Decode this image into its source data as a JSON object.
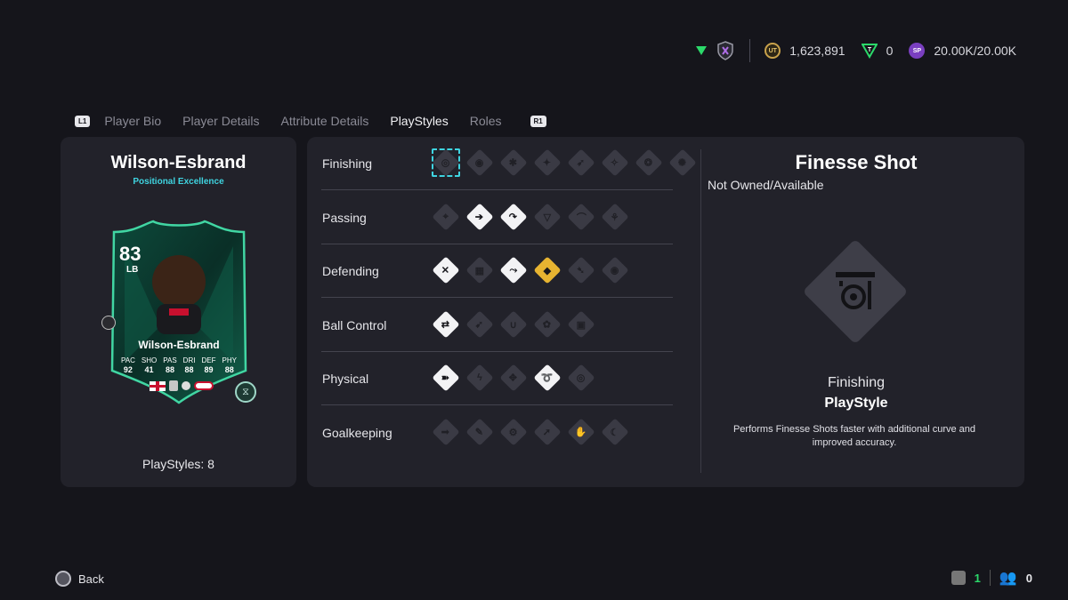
{
  "topbar": {
    "coins": "1,623,891",
    "points": "0",
    "sp": "20.00K/20.00K",
    "icons": [
      "season-triangle-icon",
      "rival-shield-icon",
      "coin-icon",
      "points-icon",
      "sp-icon"
    ]
  },
  "tabs": {
    "hint_left": "L1",
    "hint_right": "R1",
    "items": [
      {
        "label": "Player Bio"
      },
      {
        "label": "Player Details"
      },
      {
        "label": "Attribute Details"
      },
      {
        "label": "PlayStyles"
      },
      {
        "label": "Roles"
      }
    ],
    "active": "PlayStyles"
  },
  "player": {
    "name": "Wilson-Esbrand",
    "subtitle": "Positional Excellence",
    "playstyles_count": "PlayStyles: 8",
    "card": {
      "rating": "83",
      "position": "LB",
      "name": "Wilson-Esbrand",
      "stats": [
        {
          "label": "PAC",
          "value": "92"
        },
        {
          "label": "SHO",
          "value": "41"
        },
        {
          "label": "PAS",
          "value": "88"
        },
        {
          "label": "DRI",
          "value": "88"
        },
        {
          "label": "DEF",
          "value": "89"
        },
        {
          "label": "PHY",
          "value": "88"
        }
      ]
    }
  },
  "categories": [
    {
      "label": "Finishing",
      "icons": [
        {
          "name": "finesse-shot-icon",
          "state": "selected",
          "glyph": "◎"
        },
        {
          "name": "chip-shot-icon",
          "state": "locked",
          "glyph": "◉"
        },
        {
          "name": "power-shot-icon",
          "state": "locked",
          "glyph": "✱"
        },
        {
          "name": "dead-ball-icon",
          "state": "locked",
          "glyph": "✦"
        },
        {
          "name": "power-header-icon",
          "state": "locked",
          "glyph": "➶"
        },
        {
          "name": "low-driven-shot-icon",
          "state": "locked",
          "glyph": "✧"
        },
        {
          "name": "acrobatic-icon",
          "state": "locked",
          "glyph": "❂"
        },
        {
          "name": "gamechanger-icon",
          "state": "locked",
          "glyph": "✺"
        }
      ]
    },
    {
      "label": "Passing",
      "icons": [
        {
          "name": "incisive-pass-icon",
          "state": "locked",
          "glyph": "⌖"
        },
        {
          "name": "pinged-pass-icon",
          "state": "owned",
          "glyph": "➔"
        },
        {
          "name": "long-ball-pass-icon",
          "state": "owned",
          "glyph": "↷"
        },
        {
          "name": "tiki-taka-icon",
          "state": "locked",
          "glyph": "▽"
        },
        {
          "name": "whipped-pass-icon",
          "state": "locked",
          "glyph": "⌒"
        },
        {
          "name": "inventive-icon",
          "state": "locked",
          "glyph": "⚘"
        }
      ]
    },
    {
      "label": "Defending",
      "icons": [
        {
          "name": "jockey-icon",
          "state": "owned",
          "glyph": "✕"
        },
        {
          "name": "block-icon",
          "state": "locked",
          "glyph": "▦"
        },
        {
          "name": "intercept-icon",
          "state": "owned",
          "glyph": "⤳"
        },
        {
          "name": "anticipate-icon",
          "state": "plus",
          "glyph": "◆"
        },
        {
          "name": "slide-tackle-icon",
          "state": "locked",
          "glyph": "➴"
        },
        {
          "name": "bruiser-icon",
          "state": "locked",
          "glyph": "◉"
        }
      ]
    },
    {
      "label": "Ball Control",
      "icons": [
        {
          "name": "technical-icon",
          "state": "owned",
          "glyph": "⇄"
        },
        {
          "name": "rapid-icon",
          "state": "locked",
          "glyph": "➹"
        },
        {
          "name": "first-touch-icon",
          "state": "locked",
          "glyph": "∪"
        },
        {
          "name": "flair-icon",
          "state": "locked",
          "glyph": "✿"
        },
        {
          "name": "press-proven-icon",
          "state": "locked",
          "glyph": "▣"
        }
      ]
    },
    {
      "label": "Physical",
      "icons": [
        {
          "name": "quick-step-icon",
          "state": "owned",
          "glyph": "➽"
        },
        {
          "name": "relentless-icon",
          "state": "locked",
          "glyph": "ϟ"
        },
        {
          "name": "trickster-icon",
          "state": "locked",
          "glyph": "✥"
        },
        {
          "name": "long-throw-icon",
          "state": "owned",
          "glyph": "➰"
        },
        {
          "name": "aerial-icon",
          "state": "locked",
          "glyph": "◎"
        }
      ]
    },
    {
      "label": "Goalkeeping",
      "icons": [
        {
          "name": "far-throw-icon",
          "state": "locked",
          "glyph": "➟"
        },
        {
          "name": "footwork-icon",
          "state": "locked",
          "glyph": "✎"
        },
        {
          "name": "cross-claimer-icon",
          "state": "locked",
          "glyph": "⚙"
        },
        {
          "name": "rush-out-icon",
          "state": "locked",
          "glyph": "➚"
        },
        {
          "name": "far-reach-icon",
          "state": "locked",
          "glyph": "✋"
        },
        {
          "name": "deflector-icon",
          "state": "locked",
          "glyph": "☾"
        }
      ]
    }
  ],
  "detail": {
    "title": "Finesse Shot",
    "status": "Not Owned/Available",
    "category": "Finishing",
    "type": "PlayStyle",
    "description": "Performs Finesse Shots faster with additional curve and improved accuracy."
  },
  "footer": {
    "back_label": "Back",
    "count_a": "1",
    "count_b": "0"
  },
  "colors": {
    "accent": "#3fd4e0",
    "plus": "#e7b431",
    "owned": "#f3f3f5",
    "locked": "#3a3a44"
  }
}
